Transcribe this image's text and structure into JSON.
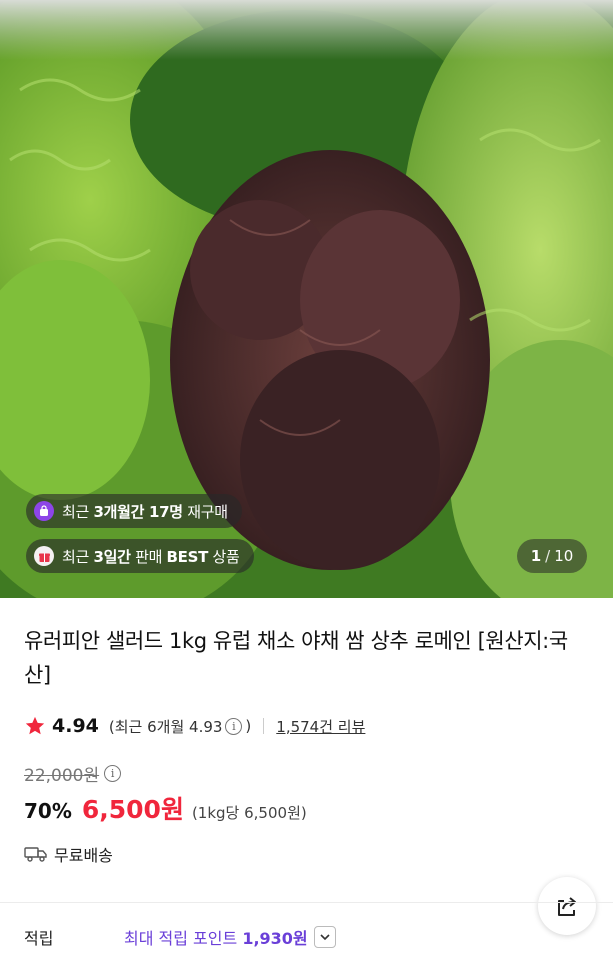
{
  "hero": {
    "image_alt": "mixed lettuce",
    "badges": [
      {
        "icon": "shopping-bag-icon",
        "pre": "최근 ",
        "highlight1": "3개월간 17명",
        "post": " 재구매"
      },
      {
        "icon": "gift-icon",
        "pre": "최근 ",
        "highlight1": "3일간",
        "mid": " 판매 ",
        "highlight2": "BEST",
        "post": " 상품"
      }
    ],
    "counter": {
      "current": "1",
      "separator": "/",
      "total": "10"
    }
  },
  "product": {
    "title": "유러피안 샐러드 1kg 유럽 채소 야채 쌈 상추 로메인 [원산지:국산]",
    "rating": {
      "score": "4.94",
      "recent_prefix": "(최근 6개월 4.93",
      "recent_suffix": ")",
      "info_glyph": "i",
      "reviews": "1,574건 리뷰"
    },
    "original_price": "22,000원",
    "discount": "70%",
    "price": "6,500원",
    "unit_price": "(1kg당 6,500원)",
    "shipping": "무료배송"
  },
  "points": {
    "label": "적립",
    "prefix": "최대 적립 포인트 ",
    "amount": "1,930원"
  },
  "colors": {
    "accent_price": "#f0263c",
    "points": "#6a3fd8",
    "star": "#f0263c"
  }
}
